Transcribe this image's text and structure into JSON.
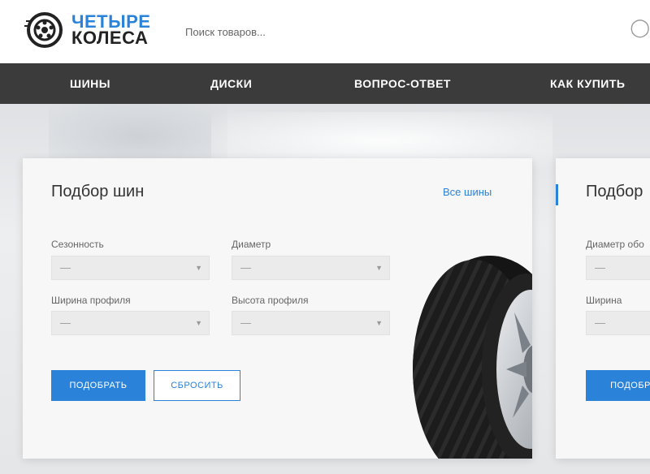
{
  "header": {
    "logo": {
      "line1": "ЧЕТЫРЕ",
      "line2": "КОЛЕСА",
      "icon": "wheel-icon"
    },
    "search": {
      "placeholder": "Поиск товаров..."
    }
  },
  "nav": {
    "items": [
      {
        "label": "ШИНЫ"
      },
      {
        "label": "ДИСКИ"
      },
      {
        "label": "ВОПРОС-ОТВЕТ"
      },
      {
        "label": "КАК КУПИТЬ"
      }
    ]
  },
  "tire_picker": {
    "title": "Подбор шин",
    "all_link": "Все шины",
    "fields": [
      {
        "label": "Сезонность",
        "value": "—"
      },
      {
        "label": "Диаметр",
        "value": "—"
      },
      {
        "label": "Ширина профиля",
        "value": "—"
      },
      {
        "label": "Высота профиля",
        "value": "—"
      }
    ],
    "submit_label": "ПОДОБРАТЬ",
    "reset_label": "СБРОСИТЬ"
  },
  "disk_picker": {
    "title": "Подбор",
    "fields": [
      {
        "label": "Диаметр обо",
        "value": "—"
      },
      {
        "label": "Ширина",
        "value": "—"
      }
    ],
    "submit_label": "ПОДОБР"
  },
  "colors": {
    "accent": "#2a83d8",
    "nav_bg": "#3b3b3b",
    "card_bg": "#f7f7f7"
  }
}
